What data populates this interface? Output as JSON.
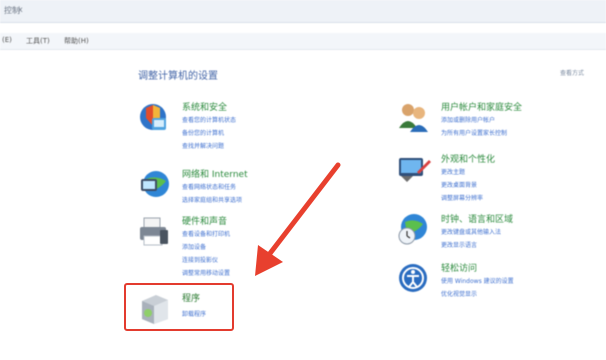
{
  "titlebar": {
    "title": "控制",
    "close": "x"
  },
  "menu": {
    "edit": "(E)",
    "tools": "工具(T)",
    "help": "帮助(H)"
  },
  "heading": "调整计算机的设置",
  "view_by": "查看方式",
  "left": [
    {
      "title": "系统和安全",
      "links": [
        "查看您的计算机状态",
        "备份您的计算机",
        "查找并解决问题"
      ]
    },
    {
      "title": "网络和 Internet",
      "links": [
        "查看网络状态和任务",
        "选择家庭组和共享选项"
      ]
    },
    {
      "title": "硬件和声音",
      "links": [
        "查看设备和打印机",
        "添加设备",
        "连接到投影仪",
        "调整常用移动设置"
      ]
    },
    {
      "title": "程序",
      "links": [
        "卸载程序"
      ]
    }
  ],
  "right": [
    {
      "title": "用户帐户和家庭安全",
      "links": [
        "添加或删除用户帐户",
        "为所有用户设置家长控制"
      ]
    },
    {
      "title": "外观和个性化",
      "links": [
        "更改主题",
        "更改桌面背景",
        "调整屏幕分辨率"
      ]
    },
    {
      "title": "时钟、语言和区域",
      "links": [
        "更改键盘或其他输入法",
        "更改显示语言"
      ]
    },
    {
      "title": "轻松访问",
      "links": [
        "使用 Windows 建议的设置",
        "优化视觉显示"
      ]
    }
  ],
  "colors": {
    "category_title": "#2a8a3c",
    "link": "#3d6fcf",
    "highlight": "#e33b2e",
    "arrow": "#e8402e"
  }
}
